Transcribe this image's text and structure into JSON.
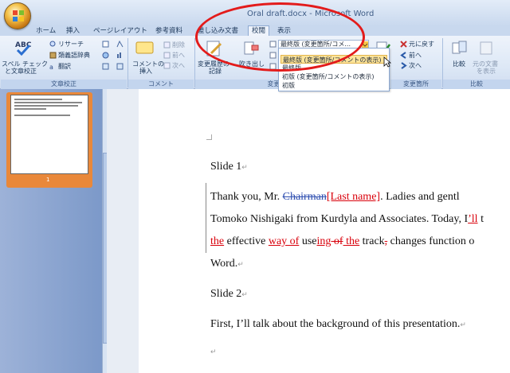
{
  "window": {
    "title": "Oral draft.docx - Microsoft Word"
  },
  "tabs": [
    "ホーム",
    "挿入",
    "ページレイアウト",
    "参考資料",
    "差し込み文書",
    "校閲",
    "表示"
  ],
  "ribbon": {
    "proofing": {
      "group_label": "文章校正",
      "spell_label": "スペル チェック",
      "spell_label2": "と文章校正",
      "research": "リサーチ",
      "thesaurus": "類義語辞典",
      "translate": "翻訳"
    },
    "comments": {
      "group_label": "コメント",
      "new_comment": "コメントの",
      "new_comment2": "挿入",
      "delete": "削除",
      "previous": "前へ",
      "next": "次へ"
    },
    "tracking": {
      "group_label": "変更履歴",
      "track_changes": "変更履歴の",
      "track_changes2": "記録",
      "balloons": "吹き出し",
      "display_value": "最終版 (変更箇所/コメ...",
      "options": [
        "最終版 (変更箇所/コメントの表示)",
        "最終版",
        "初版 (変更箇所/コメントの表示)",
        "初版"
      ]
    },
    "changes": {
      "group_label": "変更箇所",
      "reject": "元に戻す",
      "previous": "前へ",
      "next": "次へ"
    },
    "compare": {
      "group_label": "比較",
      "compare": "比較",
      "show_source": "元の文書",
      "show_source2": "を表示"
    }
  },
  "thumbnail": {
    "page_number": "1"
  },
  "document": {
    "slide1": "Slide 1",
    "slide2": "Slide 2",
    "p1_a": "Thank  you,  Mr. ",
    "p1_del": "Chairman",
    "p1_ins": "[Last  name]",
    "p1_b": ".  Ladies  and  gentl",
    "p2": "Tomoko  Nishigaki  from  Kurdyla  and  Associates.  Today,  I",
    "p2_ins": "’ll",
    "p2_tail": "  t",
    "p3_ins1": "the",
    "p3_a": "  effective  ",
    "p3_ins2": "way  of",
    "p3_b": "  use",
    "p3_ins3": "ing",
    "p3_del1": "  of",
    "p3_ins4": "  the",
    "p3_c": "  track",
    "p3_del2": ",",
    "p3_d": "  changes  function  ",
    "p3_tail": "o",
    "p4": "Word.",
    "p5": "First, I’ll talk about the background of this presentation."
  },
  "colors": {
    "annotation": "#e31b1b",
    "insert": "#d9000b",
    "delete": "#2f4fb0"
  }
}
